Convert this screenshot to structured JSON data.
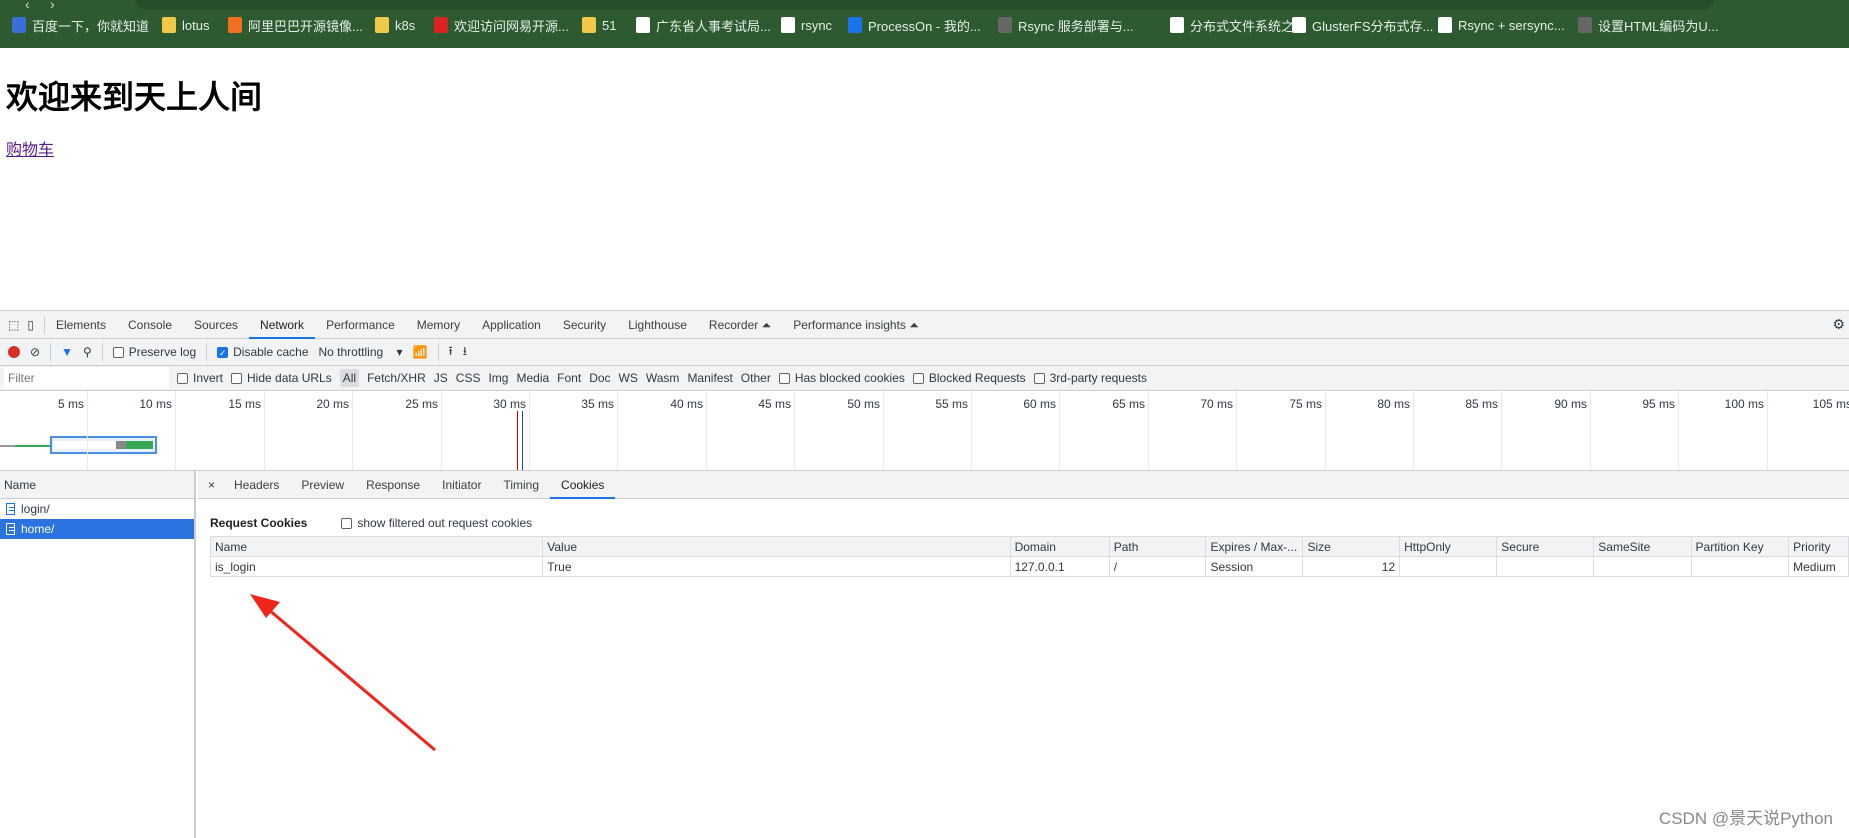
{
  "bookmarks": [
    "百度一下，你就知道",
    "lotus",
    "阿里巴巴开源镜像...",
    "k8s",
    "欢迎访问网易开源...",
    "51",
    "广东省人事考试局...",
    "rsync",
    "ProcessOn - 我的...",
    "Rsync 服务部署与...",
    "分布式文件系统之...",
    "GlusterFS分布式存...",
    "Rsync + sersync...",
    "设置HTML编码为U..."
  ],
  "page": {
    "heading": "欢迎来到天上人间",
    "link": "购物车"
  },
  "devtools": {
    "tabs": [
      "Elements",
      "Console",
      "Sources",
      "Network",
      "Performance",
      "Memory",
      "Application",
      "Security",
      "Lighthouse",
      "Recorder ⏶",
      "Performance insights ⏶"
    ],
    "active_tab": "Network",
    "toolbar": {
      "preserve_log": "Preserve log",
      "disable_cache": "Disable cache",
      "throttling": "No throttling"
    },
    "filter": {
      "placeholder": "Filter",
      "invert": "Invert",
      "hide_data_urls": "Hide data URLs",
      "types": [
        "All",
        "Fetch/XHR",
        "JS",
        "CSS",
        "Img",
        "Media",
        "Font",
        "Doc",
        "WS",
        "Wasm",
        "Manifest",
        "Other"
      ],
      "has_blocked_cookies": "Has blocked cookies",
      "blocked_requests": "Blocked Requests",
      "third_party": "3rd-party requests"
    },
    "timeline_ticks": [
      "5 ms",
      "10 ms",
      "15 ms",
      "20 ms",
      "25 ms",
      "30 ms",
      "35 ms",
      "40 ms",
      "45 ms",
      "50 ms",
      "55 ms",
      "60 ms",
      "65 ms",
      "70 ms",
      "75 ms",
      "80 ms",
      "85 ms",
      "90 ms",
      "95 ms",
      "100 ms",
      "105 ms"
    ],
    "name_header": "Name",
    "requests": [
      "login/",
      "home/"
    ],
    "detail_tabs": [
      "Headers",
      "Preview",
      "Response",
      "Initiator",
      "Timing",
      "Cookies"
    ],
    "request_cookies": "Request Cookies",
    "show_filtered": "show filtered out request cookies",
    "cookie_columns": [
      "Name",
      "Value",
      "Domain",
      "Path",
      "Expires / Max-...",
      "Size",
      "HttpOnly",
      "Secure",
      "SameSite",
      "Partition Key",
      "Priority"
    ],
    "cookie_row": [
      "is_login",
      "True",
      "127.0.0.1",
      "/",
      "Session",
      "12",
      "",
      "",
      "",
      "",
      "Medium"
    ]
  },
  "watermark": "CSDN @景天说Python"
}
